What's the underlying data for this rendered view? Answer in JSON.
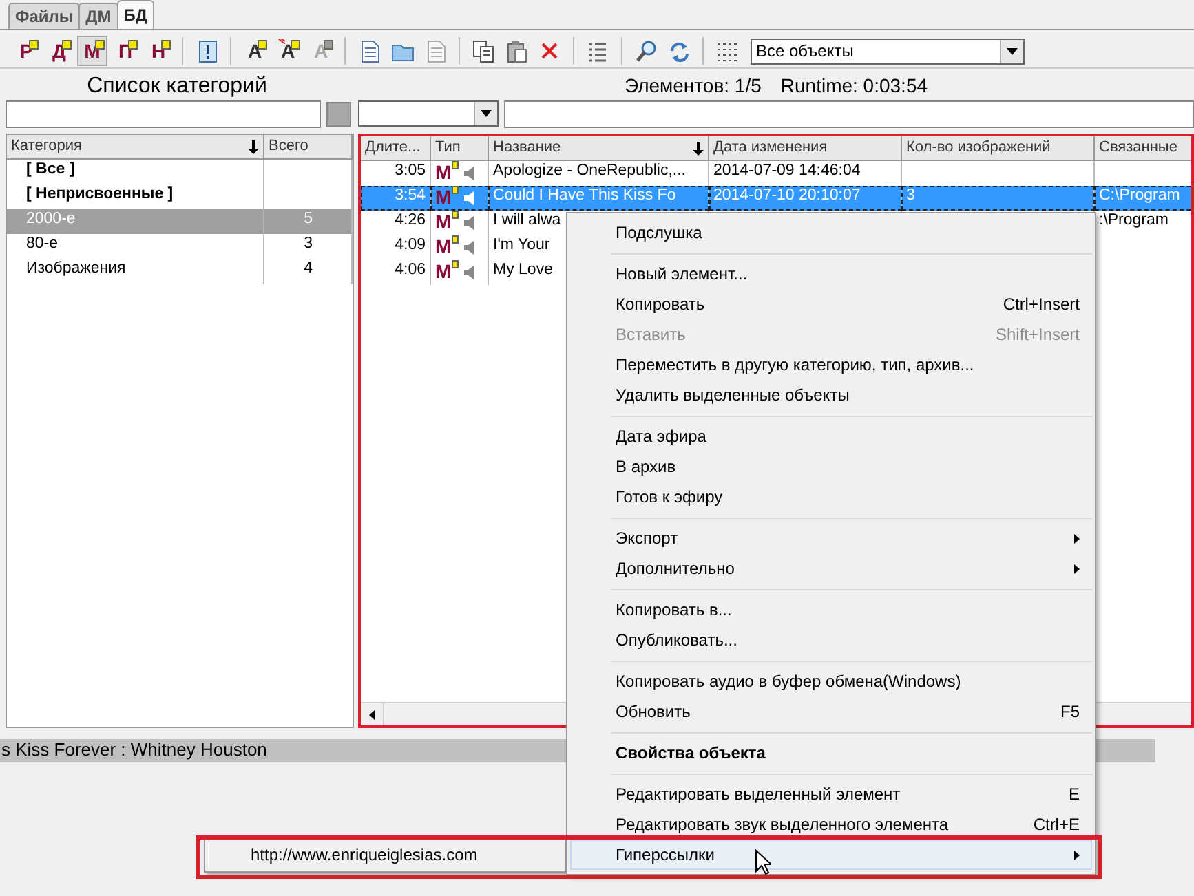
{
  "tabs": [
    {
      "label": "Файлы",
      "selected": false
    },
    {
      "label": "ДМ",
      "selected": false
    },
    {
      "label": "БД",
      "selected": true
    }
  ],
  "toolbar": [
    {
      "kind": "letter",
      "label": "Р",
      "pressed": false
    },
    {
      "kind": "letter",
      "label": "Д",
      "pressed": false
    },
    {
      "kind": "letter",
      "label": "М",
      "pressed": true
    },
    {
      "kind": "letter",
      "label": "П",
      "pressed": false
    },
    {
      "kind": "letter",
      "label": "Н",
      "pressed": false
    },
    {
      "kind": "separator"
    },
    {
      "kind": "info"
    },
    {
      "kind": "separator"
    },
    {
      "kind": "font",
      "label": "A",
      "disabled": false
    },
    {
      "kind": "font-marked",
      "label": "A",
      "disabled": false
    },
    {
      "kind": "font",
      "label": "A",
      "disabled": true
    },
    {
      "kind": "separator"
    },
    {
      "kind": "page",
      "disabled": false
    },
    {
      "kind": "folder"
    },
    {
      "kind": "page",
      "disabled": true
    },
    {
      "kind": "separator"
    },
    {
      "kind": "copy"
    },
    {
      "kind": "paste"
    },
    {
      "kind": "delete"
    },
    {
      "kind": "separator"
    },
    {
      "kind": "list"
    },
    {
      "kind": "separator"
    },
    {
      "kind": "search"
    },
    {
      "kind": "refresh"
    },
    {
      "kind": "separator"
    },
    {
      "kind": "grid"
    }
  ],
  "object_filter": {
    "value": "Все объекты"
  },
  "categories": {
    "title": "Список категорий",
    "columns": [
      "Категория",
      "Всего"
    ],
    "rows": [
      {
        "name": "[ Все ]",
        "bold": true,
        "selected": false
      },
      {
        "name": "[ Неприсвоенные ]",
        "bold": true,
        "selected": false
      },
      {
        "name": "2000-е",
        "total": "5",
        "bold": false,
        "selected": true
      },
      {
        "name": "80-е",
        "total": "3",
        "bold": false,
        "selected": false
      },
      {
        "name": "Изображения",
        "total": "4",
        "bold": false,
        "selected": false
      }
    ]
  },
  "items": {
    "count_label": "Элементов: 1/5",
    "runtime_label": "Runtime: 0:03:54",
    "columns": [
      "Длите...",
      "Тип",
      "Название",
      "Дата изменения",
      "Кол-во изображений",
      "Связанные"
    ],
    "rows": [
      {
        "duration": "3:05",
        "type": "М",
        "name": "Apologize - OneRepublic,...",
        "modified": "2014-07-09 14:46:04",
        "selected": false
      },
      {
        "duration": "3:54",
        "type": "М",
        "name": "Could I Have This Kiss Fo",
        "modified": "2014-07-10 20:10:07",
        "images": "3",
        "linked": "C:\\Program",
        "selected": true
      },
      {
        "duration": "4:26",
        "type": "М",
        "name": "I will alwa",
        "linked": ":\\Program",
        "selected": false
      },
      {
        "duration": "4:09",
        "type": "М",
        "name": "I'm Your",
        "selected": false
      },
      {
        "duration": "4:06",
        "type": "М",
        "name": "My Love",
        "selected": false
      }
    ]
  },
  "status_bar": "s Kiss Forever : Whitney Houston",
  "context_menu": {
    "items": [
      {
        "kind": "item",
        "label": "Подслушка",
        "disabled": false,
        "bold": false,
        "submenu": false,
        "selected": false
      },
      {
        "kind": "separator"
      },
      {
        "kind": "item",
        "label": "Новый элемент...",
        "disabled": false,
        "bold": false,
        "submenu": false,
        "selected": false
      },
      {
        "kind": "item",
        "label": "Копировать",
        "shortcut": "Ctrl+Insert",
        "disabled": false,
        "bold": false,
        "submenu": false,
        "selected": false
      },
      {
        "kind": "item",
        "label": "Вставить",
        "shortcut": "Shift+Insert",
        "disabled": true,
        "bold": false,
        "submenu": false,
        "selected": false
      },
      {
        "kind": "item",
        "label": "Переместить в другую категорию, тип, архив...",
        "disabled": false,
        "bold": false,
        "submenu": false,
        "selected": false
      },
      {
        "kind": "item",
        "label": "Удалить выделенные объекты",
        "disabled": false,
        "bold": false,
        "submenu": false,
        "selected": false
      },
      {
        "kind": "separator"
      },
      {
        "kind": "item",
        "label": "Дата эфира",
        "disabled": false,
        "bold": false,
        "submenu": false,
        "selected": false
      },
      {
        "kind": "item",
        "label": "В архив",
        "disabled": false,
        "bold": false,
        "submenu": false,
        "selected": false
      },
      {
        "kind": "item",
        "label": "Готов к эфиру",
        "disabled": false,
        "bold": false,
        "submenu": false,
        "selected": false
      },
      {
        "kind": "separator"
      },
      {
        "kind": "item",
        "label": "Экспорт",
        "disabled": false,
        "bold": false,
        "submenu": true,
        "selected": false
      },
      {
        "kind": "item",
        "label": "Дополнительно",
        "disabled": false,
        "bold": false,
        "submenu": true,
        "selected": false
      },
      {
        "kind": "separator"
      },
      {
        "kind": "item",
        "label": "Копировать в...",
        "disabled": false,
        "bold": false,
        "submenu": false,
        "selected": false
      },
      {
        "kind": "item",
        "label": "Опубликовать...",
        "disabled": false,
        "bold": false,
        "submenu": false,
        "selected": false
      },
      {
        "kind": "separator"
      },
      {
        "kind": "item",
        "label": "Копировать аудио в буфер обмена(Windows)",
        "disabled": false,
        "bold": false,
        "submenu": false,
        "selected": false
      },
      {
        "kind": "item",
        "label": "Обновить",
        "shortcut": "F5",
        "disabled": false,
        "bold": false,
        "submenu": false,
        "selected": false
      },
      {
        "kind": "separator"
      },
      {
        "kind": "item",
        "label": "Свойства объекта",
        "disabled": false,
        "bold": true,
        "submenu": false,
        "selected": false
      },
      {
        "kind": "separator"
      },
      {
        "kind": "item",
        "label": "Редактировать выделенный элемент",
        "shortcut": "E",
        "disabled": false,
        "bold": false,
        "submenu": false,
        "selected": false
      },
      {
        "kind": "item",
        "label": "Редактировать звук выделенного элемента",
        "shortcut": "Ctrl+E",
        "disabled": false,
        "bold": false,
        "submenu": false,
        "selected": false
      },
      {
        "kind": "item",
        "label": "Гиперссылки",
        "disabled": false,
        "bold": false,
        "submenu": true,
        "selected": true
      }
    ]
  },
  "submenu": {
    "items": [
      {
        "label": "http://www.enriqueiglesias.com"
      }
    ]
  }
}
